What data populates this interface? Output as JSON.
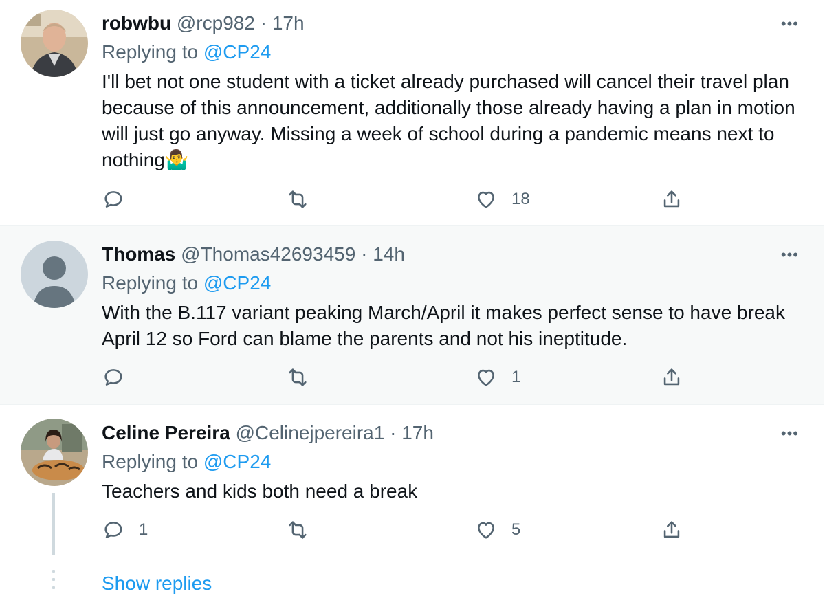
{
  "tweets": [
    {
      "name": "robwbu",
      "handle": "@rcp982",
      "separator": "·",
      "time": "17h",
      "replying_to_label": "Replying to",
      "replying_to": "@CP24",
      "text": "I'll bet not one student with a ticket already purchased will cancel their travel plan because of this announcement, additionally those already having a plan in motion will just go anyway.  Missing a week of school during a pandemic means next to nothing🤷‍♂️",
      "reply_count": "",
      "retweet_count": "",
      "like_count": "18",
      "more_label": "•••"
    },
    {
      "name": "Thomas",
      "handle": "@Thomas42693459",
      "separator": "·",
      "time": "14h",
      "replying_to_label": "Replying to",
      "replying_to": "@CP24",
      "text": "With the B.117 variant peaking March/April it makes perfect sense to have break April 12 so Ford can blame the parents and not his ineptitude.",
      "reply_count": "",
      "retweet_count": "",
      "like_count": "1",
      "more_label": "•••"
    },
    {
      "name": "Celine Pereira",
      "handle": "@Celinejpereira1",
      "separator": "·",
      "time": "17h",
      "replying_to_label": "Replying to",
      "replying_to": "@CP24",
      "text": "Teachers and kids both need a break",
      "reply_count": "1",
      "retweet_count": "",
      "like_count": "5",
      "more_label": "•••"
    }
  ],
  "show_replies": "Show replies",
  "colors": {
    "accent": "#1d9bf0",
    "muted": "#536471",
    "highlight_bg": "#f7f9f9"
  }
}
